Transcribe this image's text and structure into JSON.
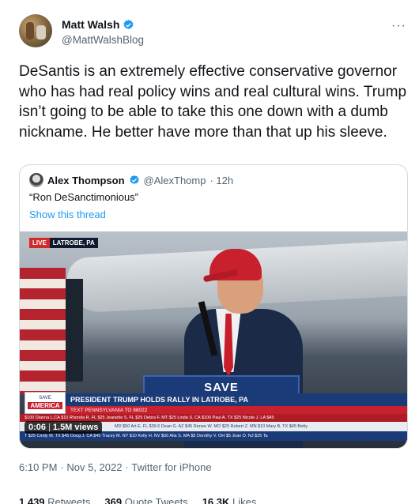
{
  "author": {
    "name": "Matt Walsh",
    "handle": "@MattWalshBlog"
  },
  "more_label": "···",
  "tweet_text": "DeSantis is an extremely effective conservative governor who has had real policy wins and real cultural wins. Trump isn’t going to be able to take this one down with a dumb nickname. He better have more than that up his sleeve.",
  "quote": {
    "name": "Alex Thompson",
    "handle": "@AlexThomp",
    "age": "· 12h",
    "text": "“Ron DeSanctimonious”",
    "show_thread": "Show this thread"
  },
  "video": {
    "live_label": "LIVE",
    "location": "LATROBE, PA",
    "sign_text": "SAVE",
    "logo_small": "SAVE",
    "logo_big": "AMERICA",
    "chyron": "PRESIDENT TRUMP HOLDS RALLY IN LATROBE, PA",
    "sub_chyron": "TEXT PENNSYLVANIA TO 88022",
    "ticker": "$100   Dianna L.CA $10   Rhonda R. FL $25   Jeanette S. FL $25   Debra F. MT $25   Linda S. CA $100   Paul A. TX $25   Nicole J. LA $45",
    "ticker2": "MD $50   Art E. FL $39.6   Dean G. AZ $45   Renee W. MO $25   Robert Z. MN $10   Mary B. TX $45   Betty",
    "ticker3": "T $25   Cindy M. TX $45   Doug J. CA $45   Tracey M. NY $10   Kelly H. NV $50   Alla S. MA $5   Dorothy V. OH $5   Joan D. NJ $25   Ta",
    "duration": "0:06",
    "views": "1.5M views"
  },
  "timestamp": {
    "time": "6:10 PM",
    "date": "· Nov 5, 2022 ·",
    "source": "Twitter for iPhone"
  },
  "stats": {
    "retweets_count": "1,439",
    "retweets_label": "Retweets",
    "quotes_count": "369",
    "quotes_label": "Quote Tweets",
    "likes_count": "16.3K",
    "likes_label": "Likes"
  },
  "colors": {
    "verified": "#1d9bf0",
    "link": "#1d9bf0",
    "muted": "#536471"
  }
}
